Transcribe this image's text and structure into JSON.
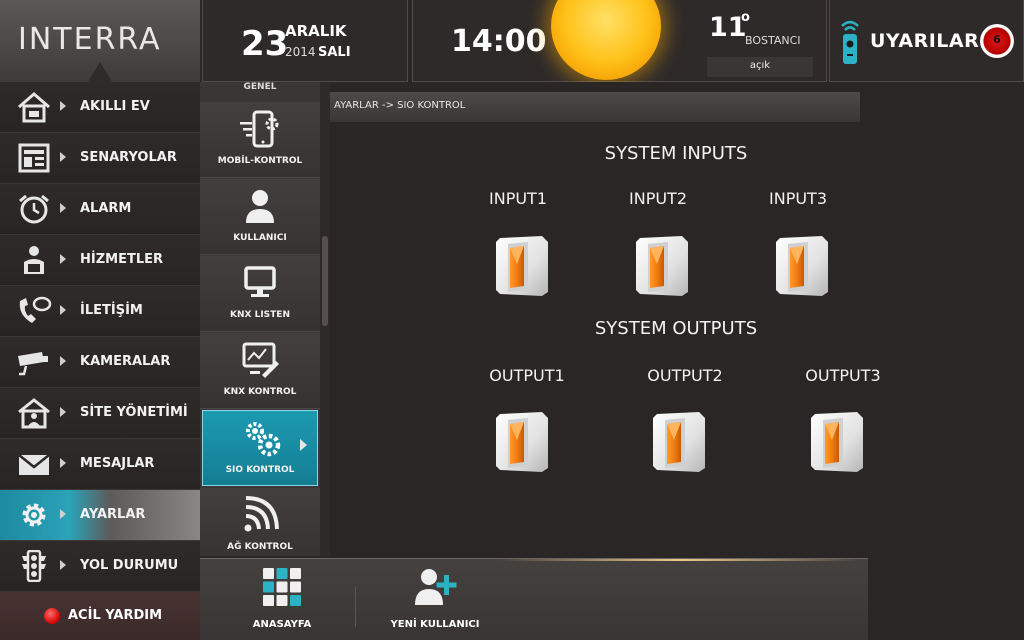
{
  "app": {
    "logo_text": "INTERRA"
  },
  "header": {
    "date": {
      "day": "23",
      "month": "ARALIK",
      "year": "2014",
      "weekday": "SALI"
    },
    "time": "14:00",
    "weather": {
      "temperature": "11",
      "degree_symbol": "o",
      "location": "BOSTANCI",
      "condition": "açık",
      "icon": "sun-icon"
    },
    "alerts": {
      "label": "UYARILAR",
      "count": "6",
      "icon": "remote-control-icon"
    }
  },
  "sidebar": {
    "items": [
      {
        "label": "AKILLI EV",
        "icon": "home-icon"
      },
      {
        "label": "SENARYOLAR",
        "icon": "scenario-icon"
      },
      {
        "label": "ALARM",
        "icon": "alarm-clock-icon"
      },
      {
        "label": "HİZMETLER",
        "icon": "services-icon"
      },
      {
        "label": "İLETİŞİM",
        "icon": "phone-chat-icon"
      },
      {
        "label": "KAMERALAR",
        "icon": "camera-icon"
      },
      {
        "label": "SİTE YÖNETİMİ",
        "icon": "site-management-icon"
      },
      {
        "label": "MESAJLAR",
        "icon": "envelope-icon"
      },
      {
        "label": "AYARLAR",
        "icon": "gear-icon",
        "active": true
      },
      {
        "label": "YOL DURUMU",
        "icon": "traffic-light-icon"
      }
    ],
    "emergency_label": "ACİL YARDIM"
  },
  "submenu": {
    "top_partial_label": "GENEL",
    "items": [
      {
        "label": "MOBİL-KONTROL",
        "icon": "mobile-control-icon"
      },
      {
        "label": "KULLANICI",
        "icon": "user-icon"
      },
      {
        "label": "KNX LISTEN",
        "icon": "monitor-icon"
      },
      {
        "label": "KNX KONTROL",
        "icon": "knx-control-icon"
      },
      {
        "label": "SIO KONTROL",
        "icon": "gears-icon",
        "active": true
      },
      {
        "label": "AĞ KONTROL",
        "icon": "wifi-icon"
      }
    ]
  },
  "main": {
    "breadcrumb": "AYARLAR -> SIO KONTROL",
    "inputs_title": "SYSTEM INPUTS",
    "inputs": [
      {
        "label": "INPUT1",
        "state": "on"
      },
      {
        "label": "INPUT2",
        "state": "on"
      },
      {
        "label": "INPUT3",
        "state": "on"
      }
    ],
    "outputs_title": "SYSTEM OUTPUTS",
    "outputs": [
      {
        "label": "OUTPUT1",
        "state": "on"
      },
      {
        "label": "OUTPUT2",
        "state": "on"
      },
      {
        "label": "OUTPUT3",
        "state": "on"
      }
    ]
  },
  "bottombar": {
    "items": [
      {
        "label": "ANASAYFA",
        "icon": "grid-home-icon"
      },
      {
        "label": "YENİ KULLANICI",
        "icon": "add-user-icon"
      }
    ]
  },
  "colors": {
    "accent": "#1c9ab2",
    "switch_orange": "#f07c10",
    "alert_red": "#d40000"
  }
}
